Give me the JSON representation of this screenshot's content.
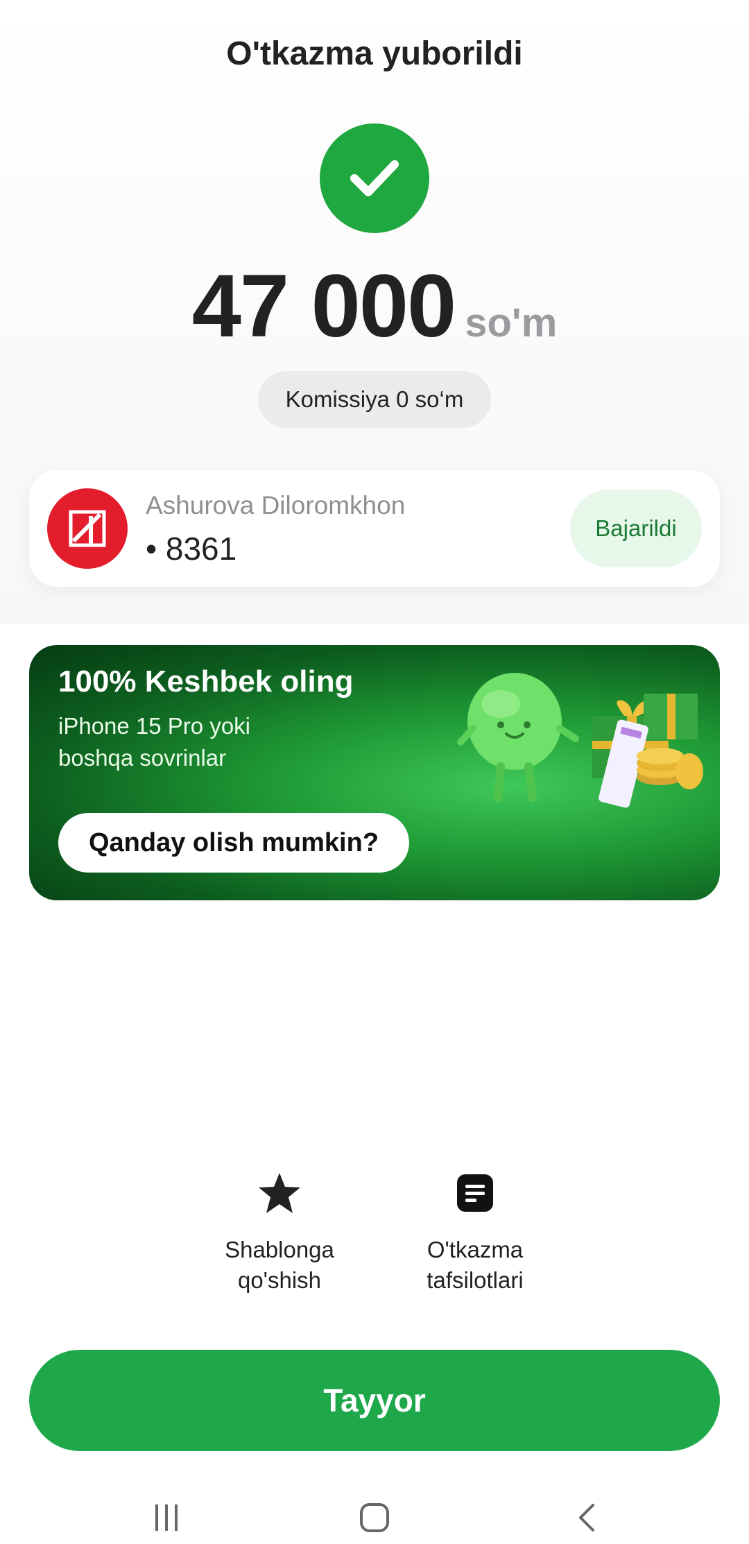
{
  "header": {
    "title": "O'tkazma yuborildi"
  },
  "amount": {
    "value": "47 000",
    "currency": "so'm"
  },
  "commission": {
    "label": "Komissiya 0 so‘m"
  },
  "recipient": {
    "name": "Ashurova Diloromkhon",
    "card_mask": "• 8361",
    "status": "Bajarildi",
    "bank_icon": "bank-logo-icon"
  },
  "promo": {
    "title": "100% Keshbek oling",
    "subtitle_line1": "iPhone 15 Pro yoki",
    "subtitle_line2": "boshqa sovrinlar",
    "button_label": "Qanday olish mumkin?"
  },
  "actions": [
    {
      "icon": "star-icon",
      "line1": "Shablonga",
      "line2": "qo'shish"
    },
    {
      "icon": "document-icon",
      "line1": "O'tkazma",
      "line2": "tafsilotlari"
    }
  ],
  "primary_button": {
    "label": "Tayyor"
  },
  "colors": {
    "success_green": "#1fa83f",
    "button_green": "#1fa84a",
    "status_bg": "#e7f7ea",
    "status_text": "#1a7a33",
    "bank_red": "#e41d2d"
  },
  "system_nav": {
    "icons": [
      "recent-apps-icon",
      "home-icon",
      "back-icon"
    ]
  }
}
